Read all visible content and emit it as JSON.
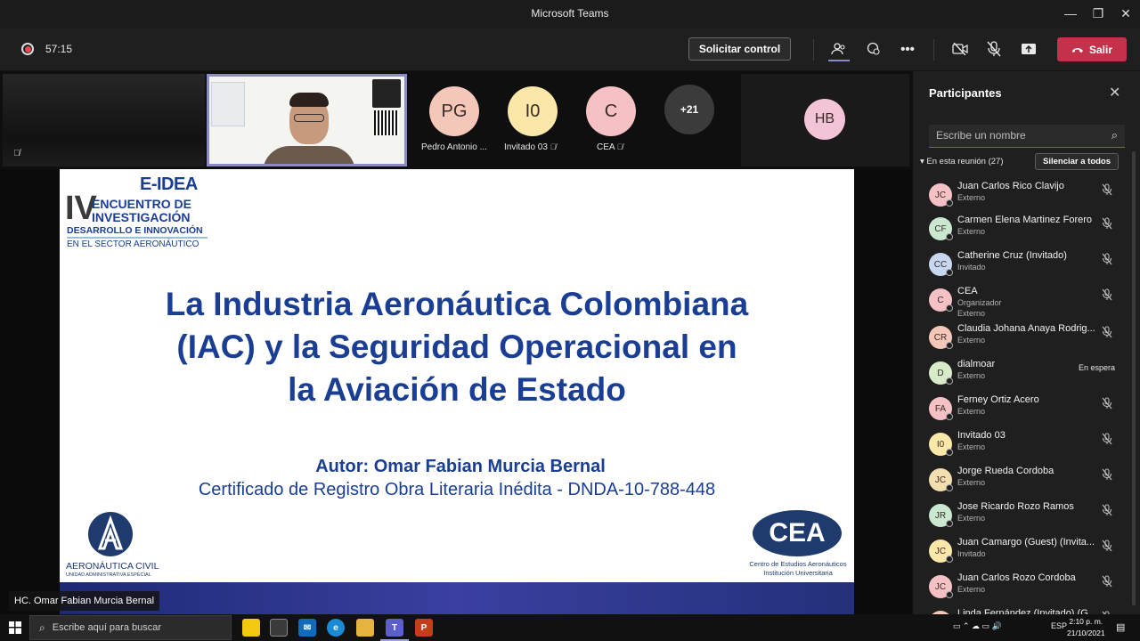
{
  "window": {
    "title": "Microsoft Teams",
    "minimize": "—",
    "restore": "❐",
    "close": "✕"
  },
  "toolbar": {
    "recording_icon": "record-icon",
    "elapsed": "57:15",
    "request_control": "Solicitar control",
    "leave": "Salir",
    "icons": [
      "participants-icon",
      "chat-icon",
      "more-icon",
      "camera-off-icon",
      "mic-off-icon",
      "share-icon",
      "phone-icon"
    ]
  },
  "strip": {
    "tiles": [
      {
        "initials": "PG",
        "name": "Pedro Antonio ...",
        "color": "#f4c7b8",
        "muted": false
      },
      {
        "initials": "I0",
        "name": "Invitado 03",
        "color": "#fbe7a8",
        "muted": true
      },
      {
        "initials": "C",
        "name": "CEA",
        "color": "#f6c1c4",
        "muted": true
      }
    ],
    "overflow": "+21",
    "spotlight": {
      "initials": "HB",
      "color": "#f3c4d8"
    }
  },
  "slide": {
    "logo_top": "E-IDEA",
    "logo_iv": "IV",
    "logo_line1": "ENCUENTRO DE",
    "logo_line2": "INVESTIGACIÓN",
    "logo_line3": "DESARROLLO E INNOVACIÓN",
    "logo_line4": "EN EL SECTOR AERONÁUTICO",
    "title_lines": [
      "La Industria Aeronáutica Colombiana",
      "(IAC) y la Seguridad Operacional en",
      "la Aviación de Estado"
    ],
    "author": "Autor: Omar Fabian Murcia Bernal",
    "certificate": "Certificado de Registro Obra Literaria Inédita - DNDA-10-788-448",
    "left_logo_name": "AERONÁUTICA CIVIL",
    "left_logo_sub": "UNIDAD ADMINISTRATIVA ESPECIAL",
    "right_logo_mark": "CEA",
    "right_logo_line1": "Centro de Estudios Aeronáuticos",
    "right_logo_line2": "Institución Universitaria"
  },
  "presenter_label": "HC. Omar Fabian Murcia Bernal",
  "panel": {
    "title": "Participantes",
    "search_placeholder": "Escribe un nombre",
    "section": "En esta reunión (27)",
    "mute_all": "Silenciar a todos",
    "participants": [
      {
        "initials": "JC",
        "name": "Juan Carlos Rico Clavijo",
        "role": "Externo",
        "color": "#f6c1c4",
        "status": ""
      },
      {
        "initials": "CF",
        "name": "Carmen Elena Martinez Forero",
        "role": "Externo",
        "color": "#c9e8cf",
        "status": ""
      },
      {
        "initials": "CC",
        "name": "Catherine Cruz (Invitado)",
        "role": "Invitado",
        "color": "#c7d7f2",
        "status": ""
      },
      {
        "initials": "C",
        "name": "CEA",
        "role": "Organizador",
        "role2": "Externo",
        "color": "#f6c1c4",
        "status": ""
      },
      {
        "initials": "CR",
        "name": "Claudia Johana Anaya Rodrig...",
        "role": "Externo",
        "color": "#f4c7b8",
        "status": ""
      },
      {
        "initials": "D",
        "name": "dialmoar",
        "role": "Externo",
        "color": "#d7ebc8",
        "status": "En espera"
      },
      {
        "initials": "FA",
        "name": "Ferney Ortiz Acero",
        "role": "Externo",
        "color": "#f6c1c4",
        "status": ""
      },
      {
        "initials": "I0",
        "name": "Invitado 03",
        "role": "Externo",
        "color": "#fbe7a8",
        "status": ""
      },
      {
        "initials": "JC",
        "name": "Jorge Rueda Cordoba",
        "role": "Externo",
        "color": "#f3deb0",
        "status": ""
      },
      {
        "initials": "JR",
        "name": "Jose Ricardo Rozo Ramos",
        "role": "Externo",
        "color": "#c9e8cf",
        "status": ""
      },
      {
        "initials": "JC",
        "name": "Juan Camargo (Guest) (Invita...",
        "role": "Invitado",
        "color": "#fbe7a8",
        "status": ""
      },
      {
        "initials": "JC",
        "name": "Juan Carlos Rozo Cordoba",
        "role": "Externo",
        "color": "#f6c1c4",
        "status": ""
      },
      {
        "initials": "LF",
        "name": "Linda Fernández (Invitado) (G...",
        "role": "",
        "color": "#f4c7b8",
        "status": ""
      }
    ]
  },
  "taskbar": {
    "search_placeholder": "Escribe aquí para buscar",
    "language": "ESP",
    "time": "2:10 p. m.",
    "date": "21/10/2021"
  }
}
